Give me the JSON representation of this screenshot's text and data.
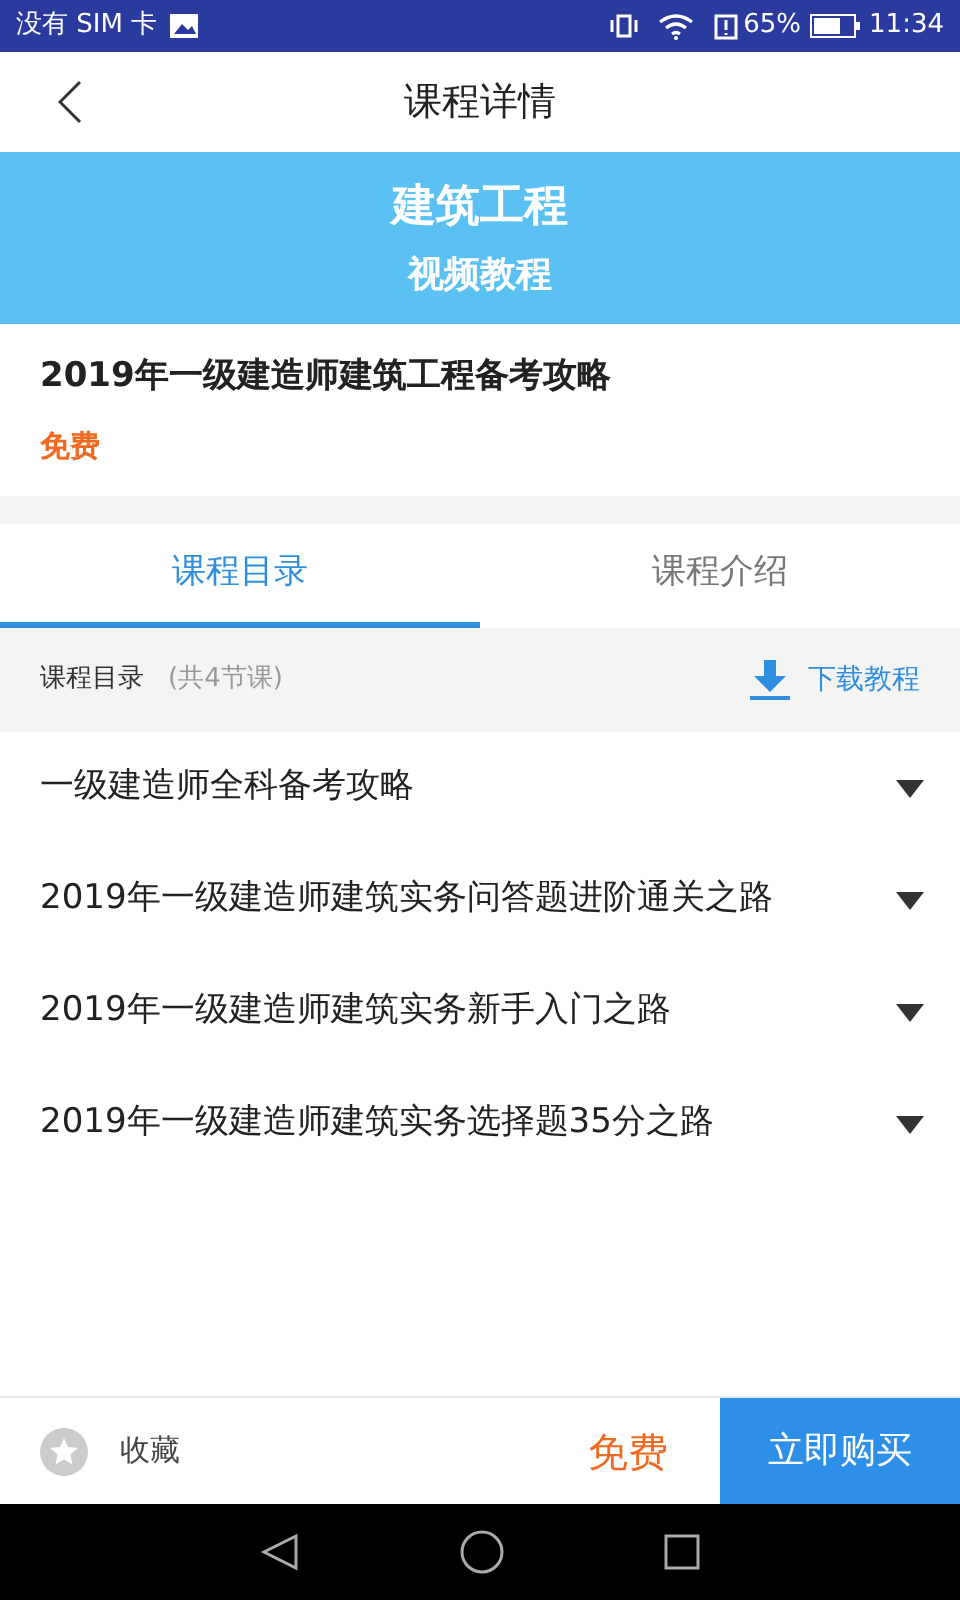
{
  "status_bar": {
    "carrier": "没有 SIM 卡",
    "battery_percent": "65%",
    "time": "11:34"
  },
  "header": {
    "title": "课程详情"
  },
  "banner": {
    "title": "建筑工程",
    "subtitle": "视频教程"
  },
  "course": {
    "title": "2019年一级建造师建筑工程备考攻略",
    "price": "免费"
  },
  "tabs": [
    {
      "label": "课程目录",
      "selected": true
    },
    {
      "label": "课程介绍",
      "selected": false
    }
  ],
  "catalog": {
    "title": "课程目录",
    "count": "(共4节课)",
    "download": "下载教程"
  },
  "chapters": [
    {
      "title": "一级建造师全科备考攻略"
    },
    {
      "title": "2019年一级建造师建筑实务问答题进阶通关之路"
    },
    {
      "title": "2019年一级建造师建筑实务新手入门之路"
    },
    {
      "title": "2019年一级建造师建筑实务选择题35分之路"
    }
  ],
  "bottom_bar": {
    "favorite_label": "收藏",
    "favorited": false,
    "price": "免费",
    "buy_button": "立即购买"
  }
}
